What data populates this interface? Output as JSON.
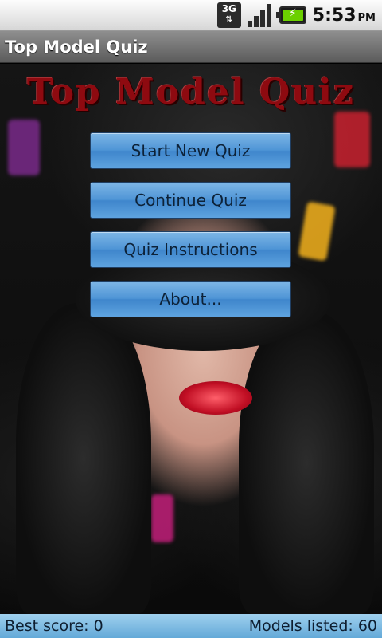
{
  "status_bar": {
    "network": "3G",
    "time": "5:53",
    "ampm": "PM"
  },
  "title_bar": {
    "title": "Top Model Quiz"
  },
  "main": {
    "logo_text": "Top Model Quiz",
    "menu": [
      {
        "label": "Start New Quiz"
      },
      {
        "label": "Continue Quiz"
      },
      {
        "label": "Quiz Instructions"
      },
      {
        "label": "About..."
      }
    ]
  },
  "footer": {
    "best_score": "Best score: 0",
    "models_listed": "Models listed: 60"
  },
  "colors": {
    "button": "#4f95d6",
    "footer": "#7fbce3",
    "logo": "#8e0a10",
    "battery": "#6bd000"
  }
}
